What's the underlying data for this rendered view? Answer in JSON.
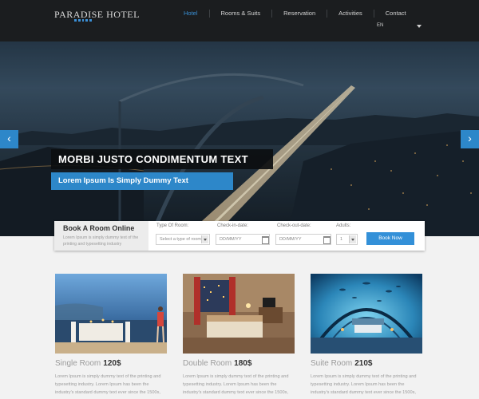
{
  "brand": {
    "name": "PARADISE HOTEL"
  },
  "nav": {
    "items": [
      "Hotel",
      "Rooms & Suits",
      "Reservation",
      "Activities",
      "Contact"
    ],
    "active_index": 0
  },
  "language": {
    "selected": "EN"
  },
  "hero": {
    "title": "MORBI JUSTO CONDIMENTUM TEXT",
    "subtitle": "Lorem Ipsum Is Simply Dummy Text",
    "prev_glyph": "‹",
    "next_glyph": "›"
  },
  "booking": {
    "title": "Book A Room Online",
    "description": "Lorem Ipsum is simply dummy text of the printing and typesetting industry",
    "type_label": "Type Of Room:",
    "type_placeholder": "Select a type of room",
    "checkin_label": "Check-in-date:",
    "checkin_placeholder": "DD/MM/YY",
    "checkout_label": "Check-out-date:",
    "checkout_placeholder": "DD/MM/YY",
    "adults_label": "Adults:",
    "adults_value": "1",
    "button": "Book Now"
  },
  "rooms": [
    {
      "name": "Single Room",
      "price": "120$",
      "desc": "Lorem Ipsum is simply dummy text of the printing and typesetting industry. Lorem Ipsum has been the industry's standard dummy text ever since the 1500s,"
    },
    {
      "name": "Double Room",
      "price": "180$",
      "desc": "Lorem Ipsum is simply dummy text of the printing and typesetting industry. Lorem Ipsum has been the industry's standard dummy text ever since the 1500s,"
    },
    {
      "name": "Suite Room",
      "price": "210$",
      "desc": "Lorem Ipsum is simply dummy text of the printing and typesetting industry. Lorem Ipsum has been the industry's standard dummy text ever since the 1500s,"
    }
  ],
  "colors": {
    "accent": "#2d87c9",
    "header_bg": "#1b1d1f",
    "active_nav": "#3a8fd4"
  }
}
